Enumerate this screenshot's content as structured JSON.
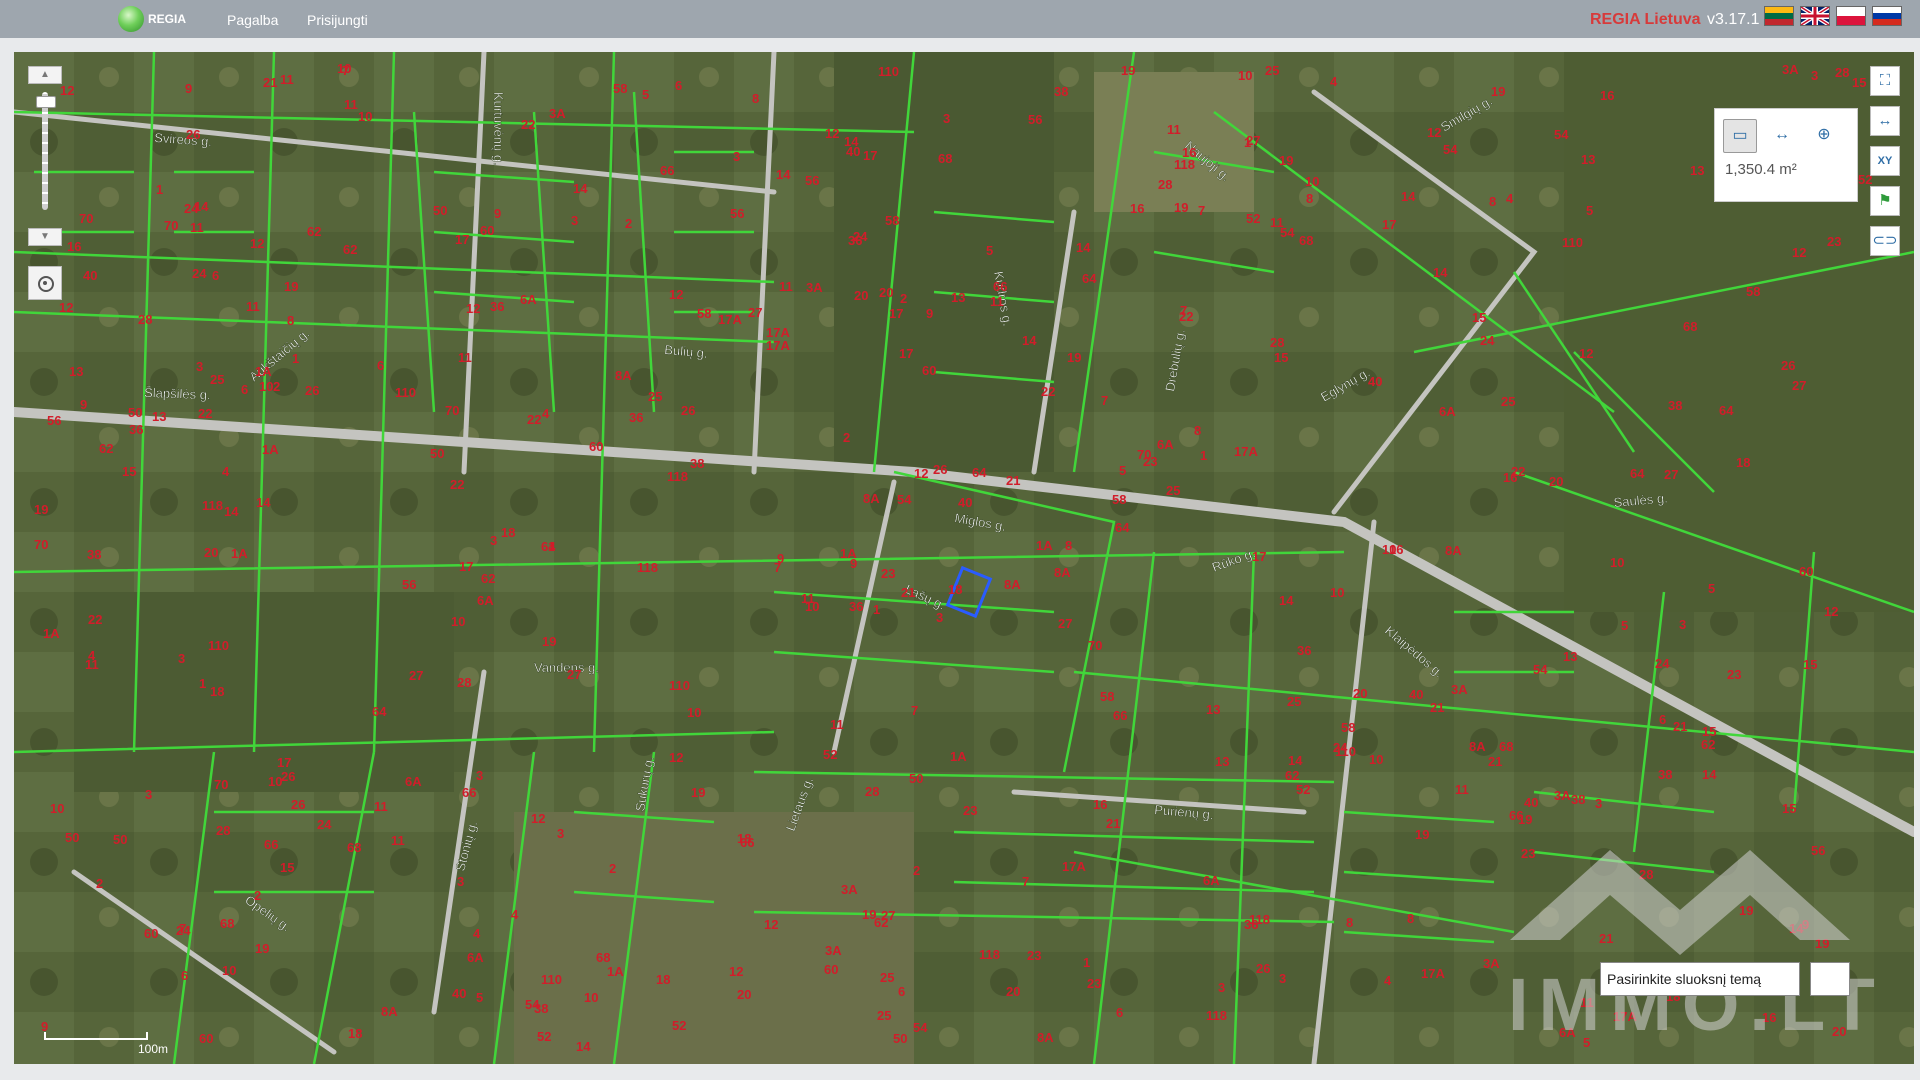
{
  "header": {
    "logo_text": "REGIA",
    "nav": [
      {
        "label": "Pagalba"
      },
      {
        "label": "Prisijungti"
      }
    ],
    "brand": "REGIA Lietuva",
    "version": "v3.17.1",
    "languages": [
      "lt",
      "en",
      "pl",
      "ru"
    ]
  },
  "colors": {
    "parcel_line": "#41d63a",
    "parcel_number": "#d11d2a",
    "road": "#c4c4c0",
    "selected_parcel": "#2a5cff",
    "brand": "#d73a3a"
  },
  "map": {
    "streets": [
      "Šlapšilės g.",
      "Svireos g.",
      "Aukštaičių g.",
      "Bulių g.",
      "Kurtuvėnų g.",
      "Kudros g.",
      "Naujoji g.",
      "Smilgių g.",
      "Drebulių g.",
      "Eglynų g.",
      "Miglos g.",
      "Rūko g.",
      "Lašų g.",
      "Vandens g.",
      "Saulės g.",
      "Klaipėdos g.",
      "Purienų g.",
      "Opelių g.",
      "Stonių g.",
      "Lietaus g.",
      "Sukurų g."
    ],
    "parcel_numbers": [
      "3",
      "11",
      "9",
      "7",
      "5",
      "3",
      "1",
      "13",
      "11",
      "8",
      "10",
      "16",
      "14",
      "12",
      "10",
      "28",
      "18",
      "20",
      "22",
      "24",
      "26",
      "6",
      "4",
      "2",
      "23",
      "21",
      "19",
      "17",
      "15",
      "25",
      "27",
      "1A",
      "3A",
      "8A",
      "6A",
      "14",
      "12",
      "17A",
      "19",
      "40",
      "38",
      "36",
      "50",
      "52",
      "54",
      "56",
      "58",
      "60",
      "62",
      "64",
      "66",
      "68",
      "70",
      "110",
      "118"
    ],
    "scale_label": "100m",
    "measure_value": "1,350.4 m²"
  },
  "tools": {
    "fullscreen_icon": "fullscreen-icon",
    "measure_area_icon": "measure-area-icon",
    "coordinates_label": "XY",
    "flag_icon": "flag-icon",
    "link_icon": "link-icon"
  },
  "layer_search": {
    "value": "Pasirinkite sluoksnį temą"
  },
  "watermark": "IMMO.LT"
}
